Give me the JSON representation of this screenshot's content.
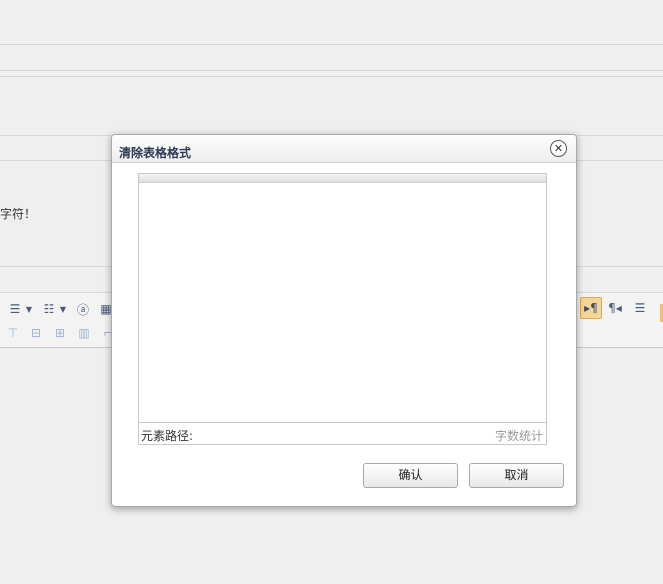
{
  "background": {
    "notice_text": "字符！"
  },
  "dialog": {
    "title": "清除表格格式",
    "close_symbol": "✕",
    "editor": {
      "path_label": "元素路径:",
      "word_count_label": "字数统计"
    },
    "buttons": {
      "confirm": "确认",
      "cancel": "取消"
    }
  },
  "toolbar": {
    "icons": [
      "ordered-list-icon",
      "unordered-list-icon",
      "anchor-icon",
      "table-icon",
      "insert-row-icon",
      "delete-row-icon",
      "merge-cells-icon",
      "insert-col-icon",
      "split-icon",
      "ltr-icon",
      "rtl-icon",
      "align-icon"
    ]
  },
  "colors": {
    "page_bg": "#efefef",
    "dialog_title": "#2b3a55",
    "active_button_bg": "#f6d59a"
  }
}
